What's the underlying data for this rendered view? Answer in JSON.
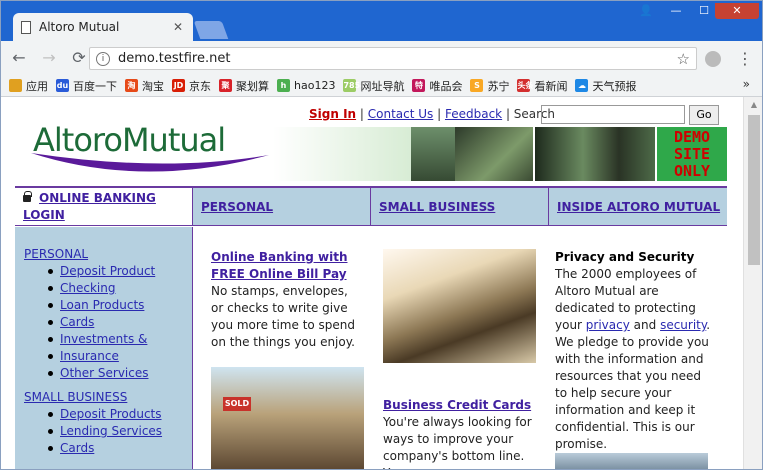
{
  "browser": {
    "tab_title": "Altoro Mutual",
    "tab_close": "✕",
    "url": "demo.testfire.net",
    "window_controls": {
      "user": "👤",
      "minimize": "—",
      "maximize": "☐",
      "close": "✕"
    },
    "nav": {
      "back": "←",
      "forward": "→",
      "reload": "⟳"
    },
    "bookmarks": [
      {
        "label": "应用",
        "color": "#e0a020",
        "glyph": ""
      },
      {
        "label": "百度一下",
        "color": "#2a5bd8",
        "glyph": "du"
      },
      {
        "label": "淘宝",
        "color": "#e64a19",
        "glyph": "淘"
      },
      {
        "label": "京东",
        "color": "#d81e06",
        "glyph": "JD"
      },
      {
        "label": "聚划算",
        "color": "#d8232a",
        "glyph": "聚"
      },
      {
        "label": "hao123",
        "color": "#4caf50",
        "glyph": "h"
      },
      {
        "label": "网址导航",
        "color": "#9ccc65",
        "glyph": "7854"
      },
      {
        "label": "唯品会",
        "color": "#c2185b",
        "glyph": "特"
      },
      {
        "label": "苏宁",
        "color": "#f9a825",
        "glyph": "S"
      },
      {
        "label": "看新闻",
        "color": "#d32f2f",
        "glyph": "头条"
      },
      {
        "label": "天气预报",
        "color": "#1e88e5",
        "glyph": "☁"
      }
    ],
    "bookmarks_more": "»"
  },
  "page": {
    "header": {
      "sign_in": "Sign In",
      "sep1": " | ",
      "contact_us": "Contact Us",
      "sep2": " | ",
      "feedback": "Feedback",
      "sep3": " | ",
      "search_label": "Search",
      "go_button": "Go"
    },
    "logo_text": "AltoroMutual",
    "demo_badge": [
      "DEMO",
      "SITE",
      "ONLY"
    ],
    "navbar": {
      "online_banking": "ONLINE BANKING LOGIN",
      "personal": "PERSONAL",
      "small_business": "SMALL BUSINESS",
      "inside": "INSIDE ALTORO MUTUAL"
    },
    "sidebar": {
      "personal_head": "PERSONAL",
      "personal_items": [
        "Deposit Product",
        "Checking",
        "Loan Products",
        "Cards",
        "Investments &",
        "Insurance",
        "Other Services"
      ],
      "business_head": "SMALL BUSINESS",
      "business_items": [
        "Deposit Products",
        "Lending Services",
        "Cards"
      ]
    },
    "col1": {
      "title_line1": "Online Banking with",
      "title_line2": "FREE Online Bill Pay",
      "body": "No stamps, envelopes, or checks to write give you more time to spend on the things you enjoy."
    },
    "sold_sign": "SOLD",
    "col2": {
      "title": "Business Credit Cards",
      "body": "You're always looking for ways to improve your company's bottom line. You"
    },
    "col3": {
      "title": "Privacy and Security",
      "body_pre": "The 2000 employees of Altoro Mutual are dedicated to protecting your ",
      "privacy": "privacy",
      "and": " and ",
      "security": "security",
      "body_post": ". We pledge to provide you with the information and resources that you need to help secure your information and keep it confidential. This is our promise."
    }
  }
}
